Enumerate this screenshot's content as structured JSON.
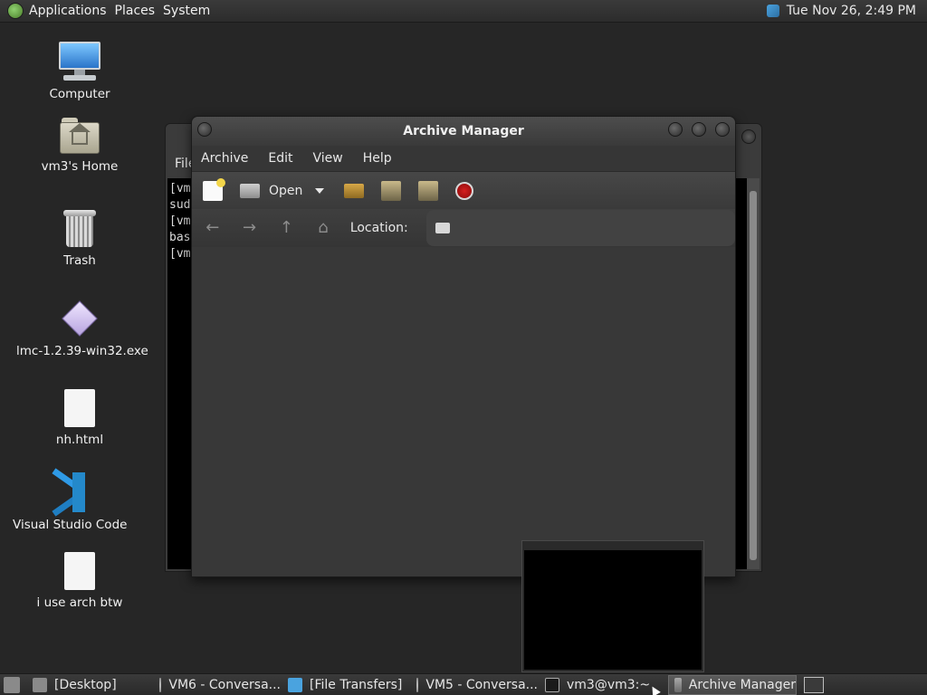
{
  "top_panel": {
    "menus": [
      "Applications",
      "Places",
      "System"
    ],
    "clock": "Tue Nov 26,  2:49 PM"
  },
  "desktop": {
    "icons": [
      {
        "label": "Computer",
        "icon": "computer-icon"
      },
      {
        "label": "vm3's Home",
        "icon": "home-folder-icon"
      },
      {
        "label": "Trash",
        "icon": "trash-icon"
      },
      {
        "label": "lmc-1.2.39-win32.exe",
        "icon": "executable-icon"
      },
      {
        "label": "nh.html",
        "icon": "file-icon"
      },
      {
        "label": "Visual Studio Code",
        "icon": "vscode-icon"
      },
      {
        "label": "i use arch btw",
        "icon": "file-icon"
      }
    ]
  },
  "terminal": {
    "menu_partial": "File",
    "lines": [
      "[vm",
      "sudo",
      "[vm",
      "bash",
      "[vm"
    ]
  },
  "archive_manager": {
    "title": "Archive Manager",
    "menus": [
      "Archive",
      "Edit",
      "View",
      "Help"
    ],
    "toolbar": {
      "open_label": "Open"
    },
    "location_label": "Location:"
  },
  "taskbar": {
    "items": [
      {
        "label": "[Desktop]",
        "icon": "desktop-icon"
      },
      {
        "label": "VM6 - Conversa...",
        "icon": "vm-icon"
      },
      {
        "label": "[File Transfers]",
        "icon": "transfer-icon"
      },
      {
        "label": "VM5 - Conversa...",
        "icon": "vm-icon"
      },
      {
        "label": "vm3@vm3:~",
        "icon": "terminal-icon"
      },
      {
        "label": "Archive Manager",
        "icon": "archive-icon"
      }
    ]
  }
}
